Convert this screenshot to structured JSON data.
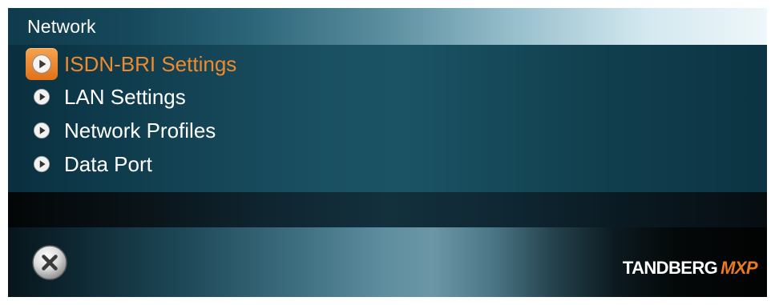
{
  "header": {
    "title": "Network"
  },
  "menu": {
    "items": [
      {
        "label": "ISDN-BRI Settings",
        "selected": true,
        "icon": "play-bullet-icon"
      },
      {
        "label": "LAN Settings",
        "selected": false,
        "icon": "play-bullet-icon"
      },
      {
        "label": "Network Profiles",
        "selected": false,
        "icon": "play-bullet-icon"
      },
      {
        "label": "Data Port",
        "selected": false,
        "icon": "play-bullet-icon"
      }
    ]
  },
  "footer": {
    "close_icon": "close-icon",
    "brand": {
      "name": "TANDBERG",
      "model": "MXP"
    }
  },
  "colors": {
    "selected_text": "#f08a2c",
    "selected_highlight": "#e97a22",
    "menu_background": "#144556",
    "text": "#ffffff"
  }
}
